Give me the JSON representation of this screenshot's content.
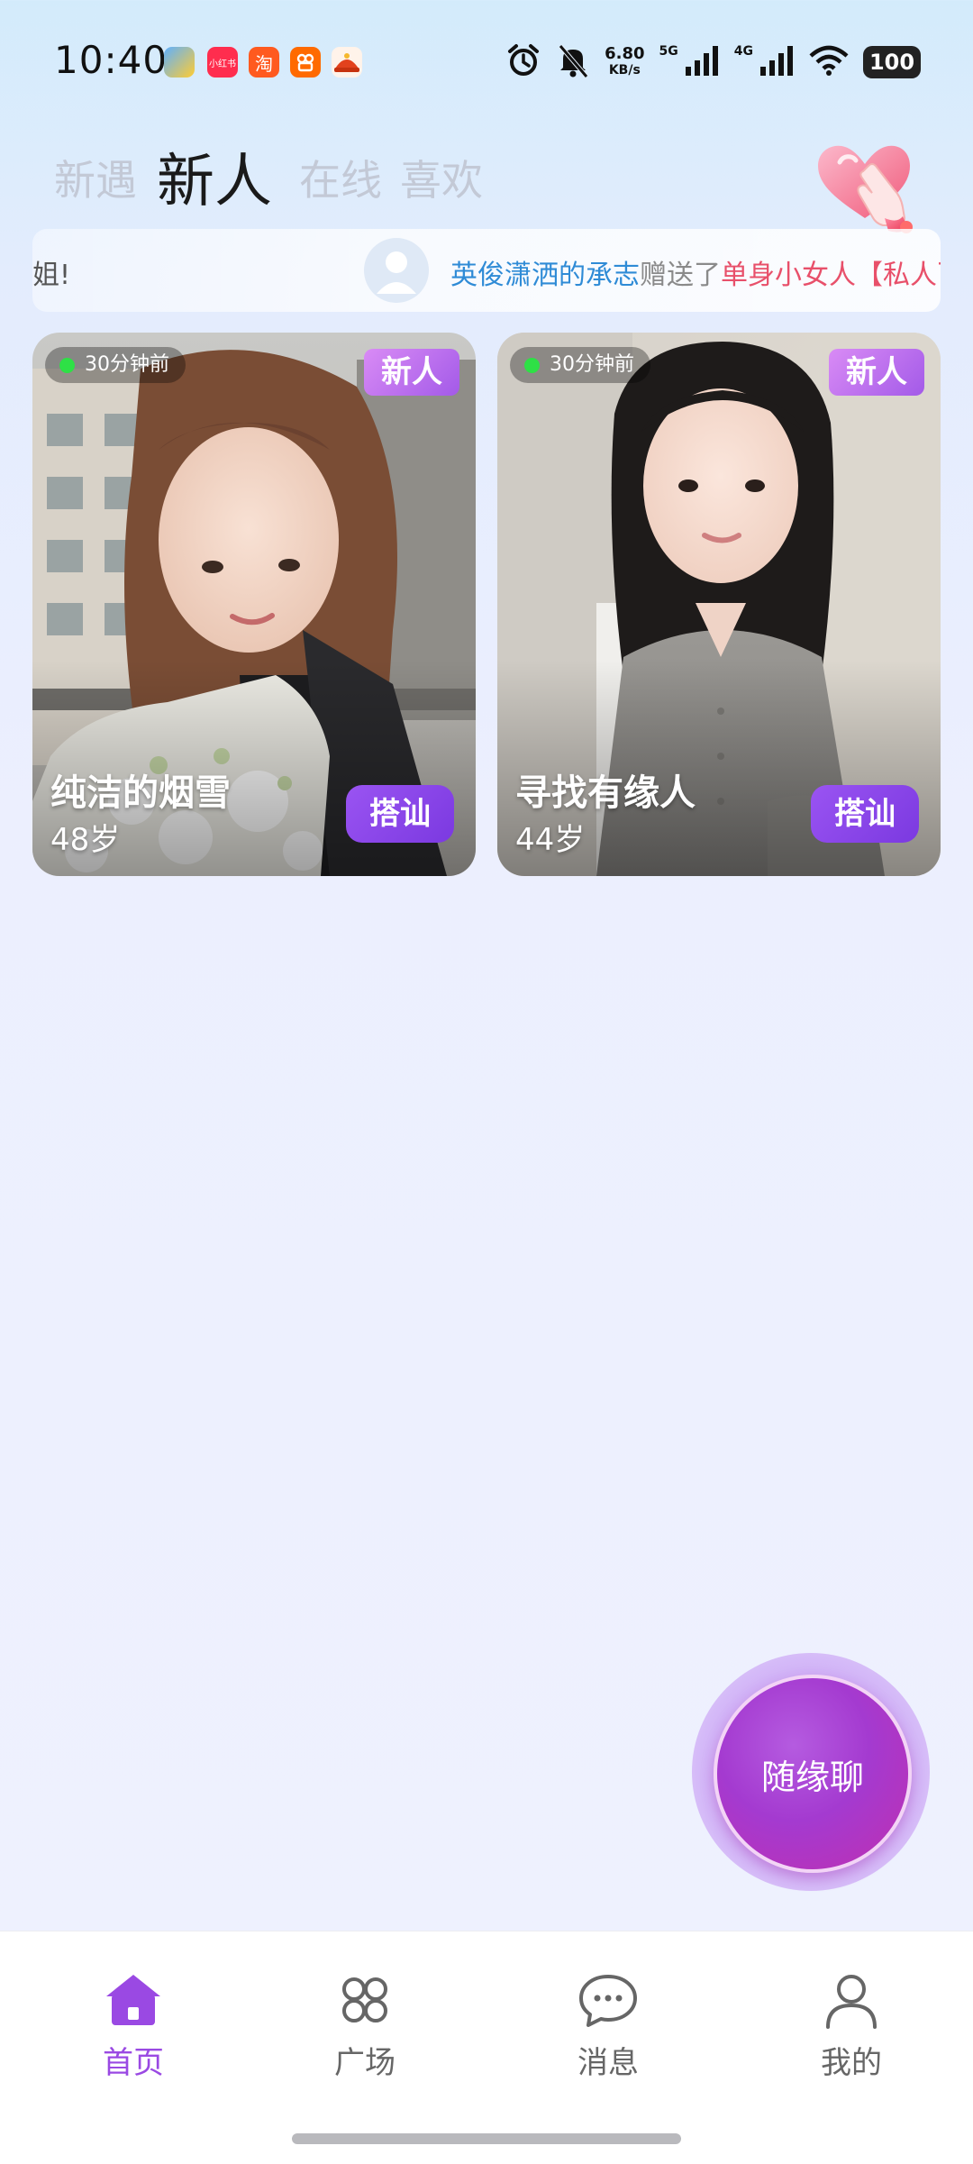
{
  "status_bar": {
    "time": "10:40",
    "net_speed_value": "6.80",
    "net_speed_unit": "KB/s",
    "sim1_label": "5G",
    "sim2_label": "4G",
    "battery": "100",
    "app_icons": [
      "alipay-icon",
      "xiaohongshu-icon",
      "taobao-icon",
      "kuaishou-icon",
      "hat-app-icon"
    ],
    "xiaohongshu_text": "小红书",
    "taobao_text": "淘"
  },
  "tabs": [
    {
      "label": "新遇",
      "active": false
    },
    {
      "label": "新人",
      "active": true
    },
    {
      "label": "在线",
      "active": false
    },
    {
      "label": "喜欢",
      "active": false
    }
  ],
  "marquee": {
    "prev_fragment": "姐!",
    "user_name": "英俊潇洒的承志",
    "verb": "赠送了",
    "gift_text": "单身小女人【私人飞"
  },
  "cards": [
    {
      "last_seen": "30分钟前",
      "badge": "新人",
      "name": "纯洁的烟雪",
      "age": "48岁",
      "action_label": "搭讪"
    },
    {
      "last_seen": "30分钟前",
      "badge": "新人",
      "name": "寻找有缘人",
      "age": "44岁",
      "action_label": "搭讪"
    }
  ],
  "random_chat_label": "随缘聊",
  "bottom_nav": [
    {
      "label": "首页",
      "icon": "home-icon",
      "active": true
    },
    {
      "label": "广场",
      "icon": "grid-icon",
      "active": false
    },
    {
      "label": "消息",
      "icon": "message-icon",
      "active": false
    },
    {
      "label": "我的",
      "icon": "person-icon",
      "active": false
    }
  ],
  "colors": {
    "accent": "#9a49e3",
    "online": "#2ee046",
    "marquee_user": "#2f8bd6",
    "marquee_gift": "#e8506a"
  }
}
